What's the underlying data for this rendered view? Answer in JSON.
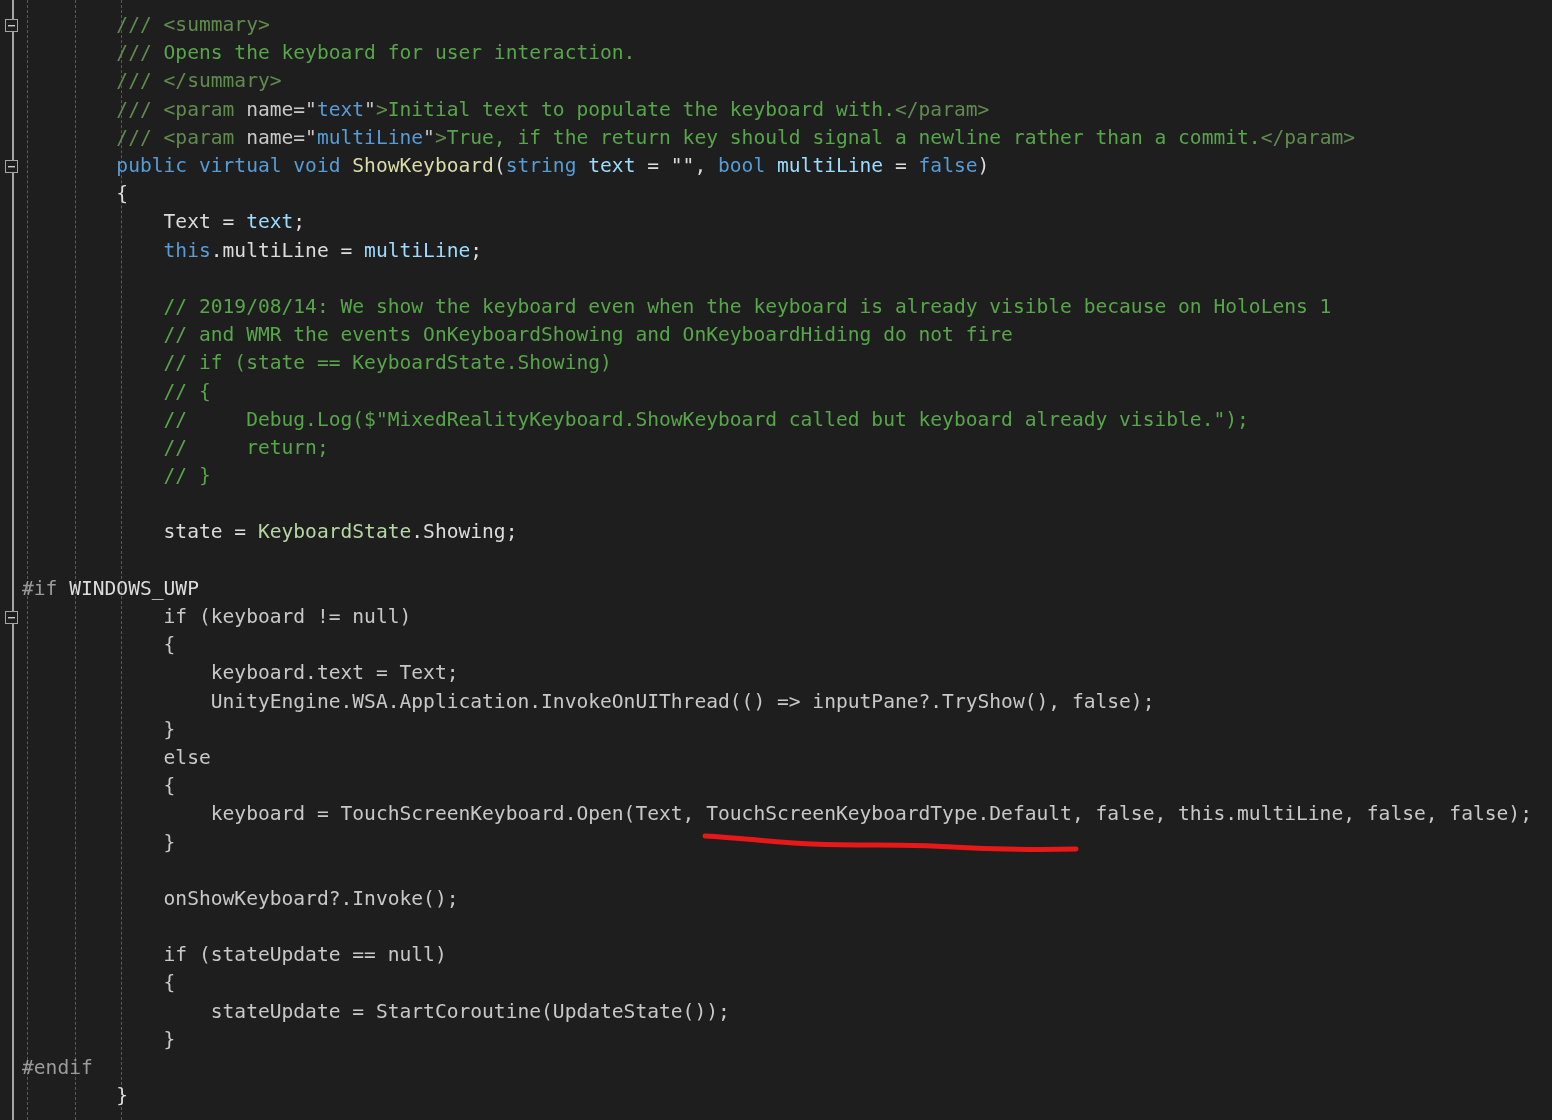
{
  "editor": {
    "lines": [
      {
        "kind": "code",
        "fold": {
          "expanded": true
        },
        "tokens": [
          {
            "kind": "doc-tag",
            "text": "        /// <summary>"
          }
        ]
      },
      {
        "kind": "code",
        "tokens": [
          {
            "kind": "doc-tag",
            "text": "        ///"
          },
          {
            "kind": "doc",
            "text": " Opens the keyboard for user interaction."
          }
        ]
      },
      {
        "kind": "code",
        "tokens": [
          {
            "kind": "doc-tag",
            "text": "        /// </summary>"
          }
        ]
      },
      {
        "kind": "code",
        "tokens": [
          {
            "kind": "doc-tag",
            "text": "        /// <param "
          },
          {
            "kind": "doc-attr",
            "text": "name=\""
          },
          {
            "kind": "doc-value",
            "text": "text"
          },
          {
            "kind": "doc-attr",
            "text": "\""
          },
          {
            "kind": "doc-tag",
            "text": ">"
          },
          {
            "kind": "doc",
            "text": "Initial text to populate the keyboard with."
          },
          {
            "kind": "doc-tag",
            "text": "</param>"
          }
        ]
      },
      {
        "kind": "code",
        "tokens": [
          {
            "kind": "doc-tag",
            "text": "        /// <param "
          },
          {
            "kind": "doc-attr",
            "text": "name=\""
          },
          {
            "kind": "doc-value",
            "text": "multiLine"
          },
          {
            "kind": "doc-attr",
            "text": "\""
          },
          {
            "kind": "doc-tag",
            "text": ">"
          },
          {
            "kind": "doc",
            "text": "True, if the return key should signal a newline rather than a commit."
          },
          {
            "kind": "doc-tag",
            "text": "</param>"
          }
        ]
      },
      {
        "kind": "code",
        "fold": {
          "expanded": true
        },
        "tokens": [
          {
            "kind": "keyword",
            "text": "        public virtual void "
          },
          {
            "kind": "method",
            "text": "ShowKeyboard"
          },
          {
            "kind": "plain",
            "text": "("
          },
          {
            "kind": "keyword",
            "text": "string "
          },
          {
            "kind": "param",
            "text": "text"
          },
          {
            "kind": "plain",
            "text": " = \"\", "
          },
          {
            "kind": "keyword",
            "text": "bool "
          },
          {
            "kind": "param",
            "text": "multiLine"
          },
          {
            "kind": "plain",
            "text": " = "
          },
          {
            "kind": "keyword",
            "text": "false"
          },
          {
            "kind": "plain",
            "text": ")"
          }
        ]
      },
      {
        "kind": "code",
        "tokens": [
          {
            "kind": "plain",
            "text": "        {"
          }
        ]
      },
      {
        "kind": "code",
        "tokens": [
          {
            "kind": "plain",
            "text": "            Text = "
          },
          {
            "kind": "param",
            "text": "text"
          },
          {
            "kind": "plain",
            "text": ";"
          }
        ]
      },
      {
        "kind": "code",
        "tokens": [
          {
            "kind": "keyword",
            "text": "            this"
          },
          {
            "kind": "plain",
            "text": ".multiLine = "
          },
          {
            "kind": "param",
            "text": "multiLine"
          },
          {
            "kind": "plain",
            "text": ";"
          }
        ]
      },
      {
        "kind": "blank"
      },
      {
        "kind": "code",
        "tokens": [
          {
            "kind": "comment",
            "text": "            // 2019/08/14: We show the keyboard even when the keyboard is already visible because on HoloLens 1"
          }
        ]
      },
      {
        "kind": "code",
        "tokens": [
          {
            "kind": "comment",
            "text": "            // and WMR the events OnKeyboardShowing and OnKeyboardHiding do not fire"
          }
        ]
      },
      {
        "kind": "code",
        "tokens": [
          {
            "kind": "comment",
            "text": "            // if (state == KeyboardState.Showing)"
          }
        ]
      },
      {
        "kind": "code",
        "tokens": [
          {
            "kind": "comment",
            "text": "            // {"
          }
        ]
      },
      {
        "kind": "code",
        "tokens": [
          {
            "kind": "comment",
            "text": "            //     Debug.Log($\"MixedRealityKeyboard.ShowKeyboard called but keyboard already visible.\");"
          }
        ]
      },
      {
        "kind": "code",
        "tokens": [
          {
            "kind": "comment",
            "text": "            //     return;"
          }
        ]
      },
      {
        "kind": "code",
        "tokens": [
          {
            "kind": "comment",
            "text": "            // }"
          }
        ]
      },
      {
        "kind": "blank"
      },
      {
        "kind": "code",
        "tokens": [
          {
            "kind": "plain",
            "text": "            state = "
          },
          {
            "kind": "enum",
            "text": "KeyboardState"
          },
          {
            "kind": "plain",
            "text": ".Showing;"
          }
        ]
      },
      {
        "kind": "blank"
      },
      {
        "kind": "code",
        "tokens": [
          {
            "kind": "preproc",
            "text": "#if "
          },
          {
            "kind": "plain",
            "text": "WINDOWS_UWP"
          }
        ]
      },
      {
        "kind": "code",
        "fold": {
          "expanded": true
        },
        "tokens": [
          {
            "kind": "inactive",
            "text": "            if (keyboard != null)"
          }
        ]
      },
      {
        "kind": "code",
        "tokens": [
          {
            "kind": "inactive",
            "text": "            {"
          }
        ]
      },
      {
        "kind": "code",
        "tokens": [
          {
            "kind": "inactive",
            "text": "                keyboard.text = Text;"
          }
        ]
      },
      {
        "kind": "code",
        "tokens": [
          {
            "kind": "inactive",
            "text": "                UnityEngine.WSA.Application.InvokeOnUIThread(() => inputPane?.TryShow(), false);"
          }
        ]
      },
      {
        "kind": "code",
        "tokens": [
          {
            "kind": "inactive",
            "text": "            }"
          }
        ]
      },
      {
        "kind": "code",
        "tokens": [
          {
            "kind": "inactive",
            "text": "            else"
          }
        ]
      },
      {
        "kind": "code",
        "tokens": [
          {
            "kind": "inactive",
            "text": "            {"
          }
        ]
      },
      {
        "kind": "code",
        "tokens": [
          {
            "kind": "inactive",
            "text": "                keyboard = TouchScreenKeyboard.Open(Text, TouchScreenKeyboardType.Default, false, this.multiLine, false, false);"
          }
        ]
      },
      {
        "kind": "code",
        "tokens": [
          {
            "kind": "inactive",
            "text": "            }"
          }
        ]
      },
      {
        "kind": "blank"
      },
      {
        "kind": "code",
        "tokens": [
          {
            "kind": "inactive",
            "text": "            onShowKeyboard?.Invoke();"
          }
        ]
      },
      {
        "kind": "blank"
      },
      {
        "kind": "code",
        "tokens": [
          {
            "kind": "inactive",
            "text": "            if (stateUpdate == null)"
          }
        ]
      },
      {
        "kind": "code",
        "tokens": [
          {
            "kind": "inactive",
            "text": "            {"
          }
        ]
      },
      {
        "kind": "code",
        "tokens": [
          {
            "kind": "inactive",
            "text": "                stateUpdate = StartCoroutine(UpdateState());"
          }
        ]
      },
      {
        "kind": "code",
        "tokens": [
          {
            "kind": "inactive",
            "text": "            }"
          }
        ]
      },
      {
        "kind": "code",
        "tokens": [
          {
            "kind": "preproc",
            "text": "#endif"
          }
        ]
      },
      {
        "kind": "code",
        "tokens": [
          {
            "kind": "plain",
            "text": "        }"
          }
        ]
      }
    ]
  }
}
